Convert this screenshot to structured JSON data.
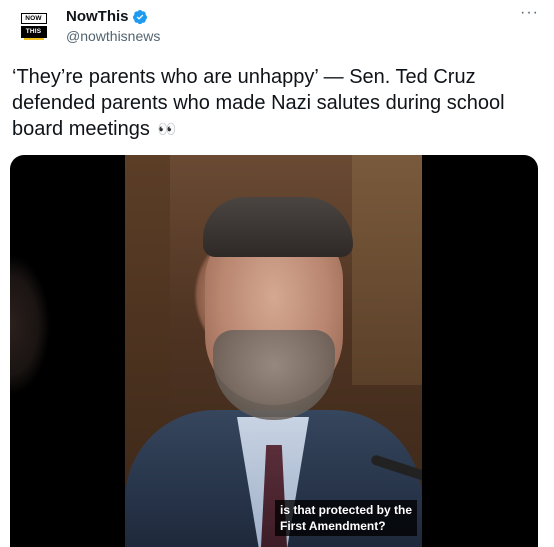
{
  "account": {
    "name": "NowThis",
    "handle": "@nowthisnews",
    "logo_top": "NOW",
    "logo_bottom": "THIS",
    "verified_color": "#1d9bf0"
  },
  "menu": {
    "more_label": "···"
  },
  "tweet": {
    "text": "‘They’re parents who are unhappy’ — Sen. Ted Cruz defended parents who made Nazi salutes during school board meetings",
    "emoji": "👀"
  },
  "media": {
    "caption": "is that protected by the\nFirst Amendment?"
  }
}
